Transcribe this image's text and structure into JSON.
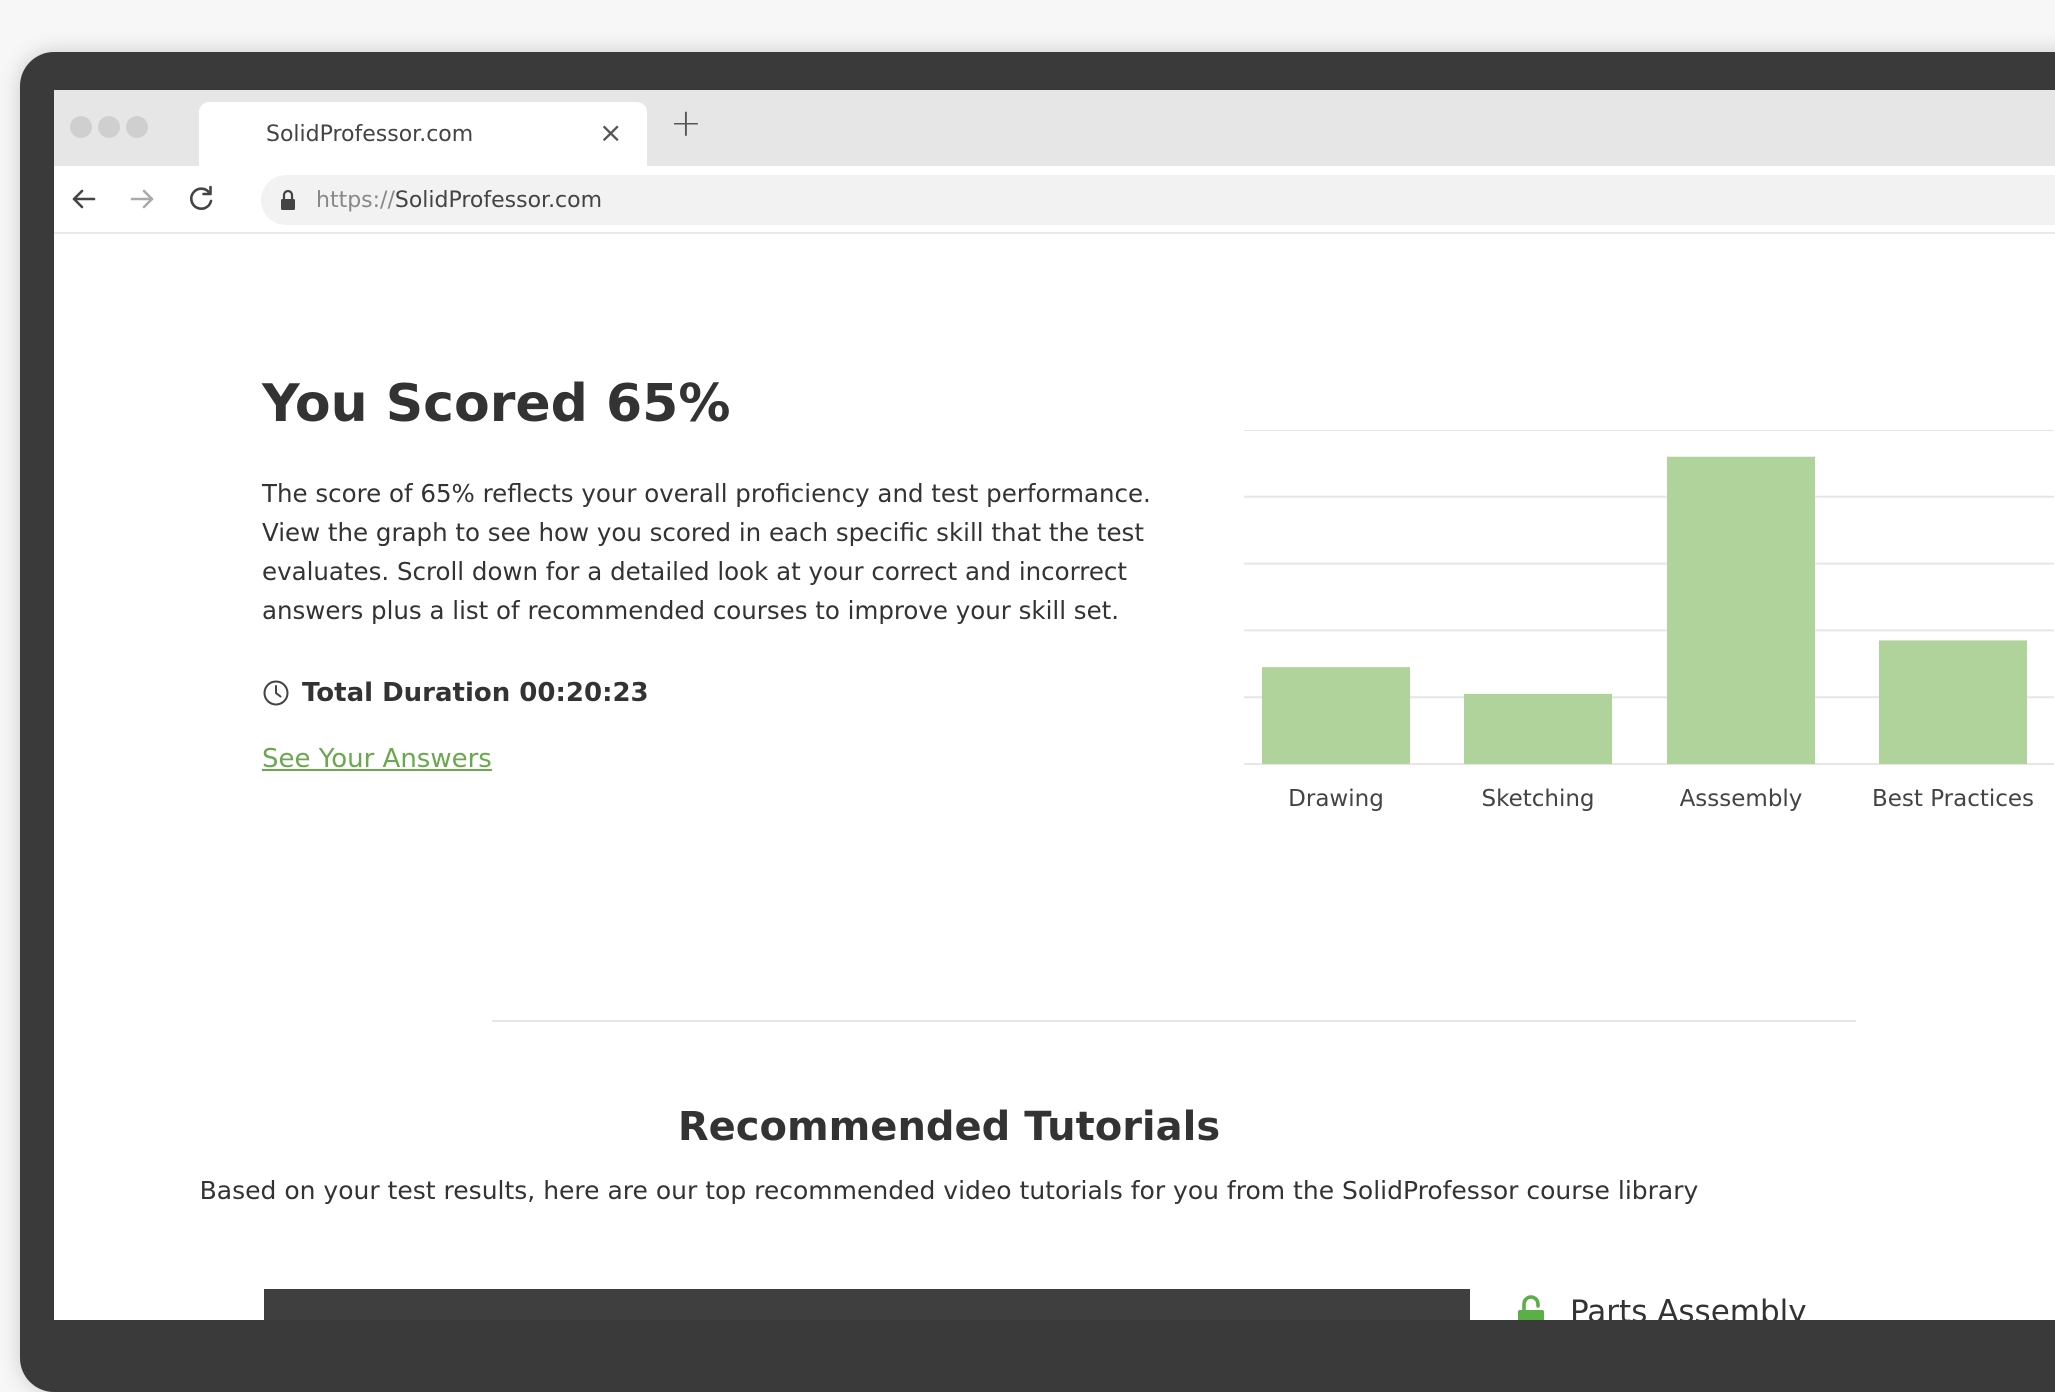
{
  "browser": {
    "tab_title": "SolidProfessor.com",
    "tab_close": "×",
    "new_tab": "+",
    "url_scheme": "https://",
    "url_host": "SolidProfessor.com"
  },
  "results": {
    "title": "You Scored 65%",
    "description": "The score of 65% reflects your overall proficiency and test performance. View the graph to see how you scored in each specific skill that the test evaluates. Scroll down for a detailed look at your correct and incorrect answers plus a list of recommended courses to improve your skill set.",
    "duration": "Total Duration 00:20:23",
    "answers_link": "See Your Answers"
  },
  "chart_data": {
    "type": "bar",
    "categories": [
      "Drawing",
      "Sketching",
      "Asssembly",
      "Best Practices"
    ],
    "values": [
      29,
      21,
      92,
      37
    ],
    "ylim": [
      0,
      100
    ],
    "grid": true,
    "bar_color": "#b0d29b"
  },
  "recommended": {
    "title": "Recommended Tutorials",
    "subtitle": "Based on your test results, here are our top recommended video tutorials for you from the SolidProfessor course library",
    "first_course": "Parts Assembly"
  },
  "colors": {
    "accent": "#6aa84f",
    "lock_green": "#5cae48"
  }
}
